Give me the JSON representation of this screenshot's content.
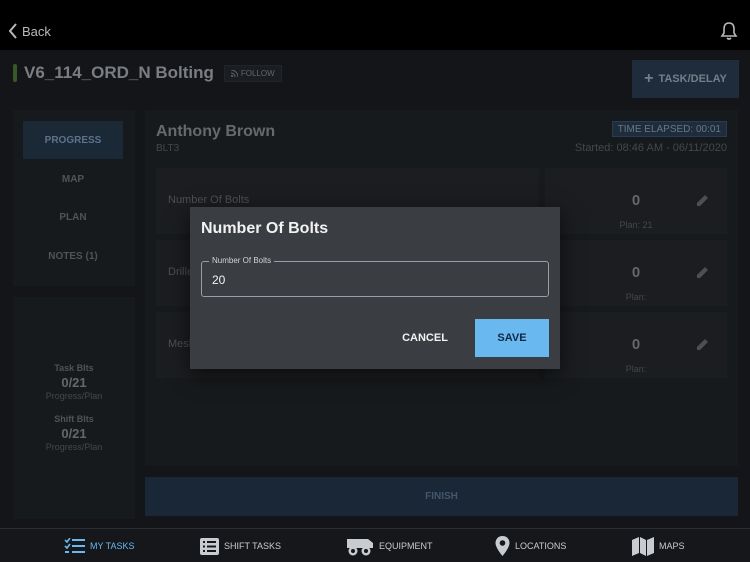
{
  "header": {
    "back_label": "Back"
  },
  "task": {
    "title": "V6_114_ORD_N Bolting",
    "follow_label": "FOLLOW",
    "task_delay_label": "TASK/DELAY"
  },
  "nav": {
    "items": [
      {
        "label": "PROGRESS",
        "active": true
      },
      {
        "label": "MAP"
      },
      {
        "label": "PLAN"
      },
      {
        "label": "NOTES (1)"
      }
    ]
  },
  "stats": {
    "task": {
      "label": "Task Blts",
      "value": "0/21",
      "sub": "Progress/Plan"
    },
    "shift": {
      "label": "Shift Blts",
      "value": "0/21",
      "sub": "Progress/Plan"
    }
  },
  "worker": {
    "name": "Anthony Brown",
    "code": "BLT3",
    "elapsed": "TIME ELAPSED: 00:01",
    "started": "Started: 08:46 AM - 06/11/2020"
  },
  "rows": [
    {
      "name": "Number Of Bolts",
      "value": "0",
      "plan": "Plan: 21"
    },
    {
      "name": "Drilled",
      "value": "0",
      "plan": "Plan:"
    },
    {
      "name": "Mesh",
      "value": "0",
      "plan": "Plan:"
    }
  ],
  "finish_label": "FINISH",
  "dialog": {
    "title": "Number Of Bolts",
    "field_label": "Number Of Bolts",
    "field_value": "20",
    "cancel_label": "CANCEL",
    "save_label": "SAVE"
  },
  "bottom_nav": [
    {
      "label": "MY TASKS",
      "icon": "checklist-icon",
      "active": true
    },
    {
      "label": "SHIFT TASKS",
      "icon": "list-icon"
    },
    {
      "label": "EQUIPMENT",
      "icon": "truck-icon"
    },
    {
      "label": "LOCATIONS",
      "icon": "location-pin-icon"
    },
    {
      "label": "MAPS",
      "icon": "map-icon"
    }
  ],
  "colors": {
    "accent": "#6ab8f0",
    "background": "#1b1e22",
    "dialog": "#3a3d42"
  }
}
